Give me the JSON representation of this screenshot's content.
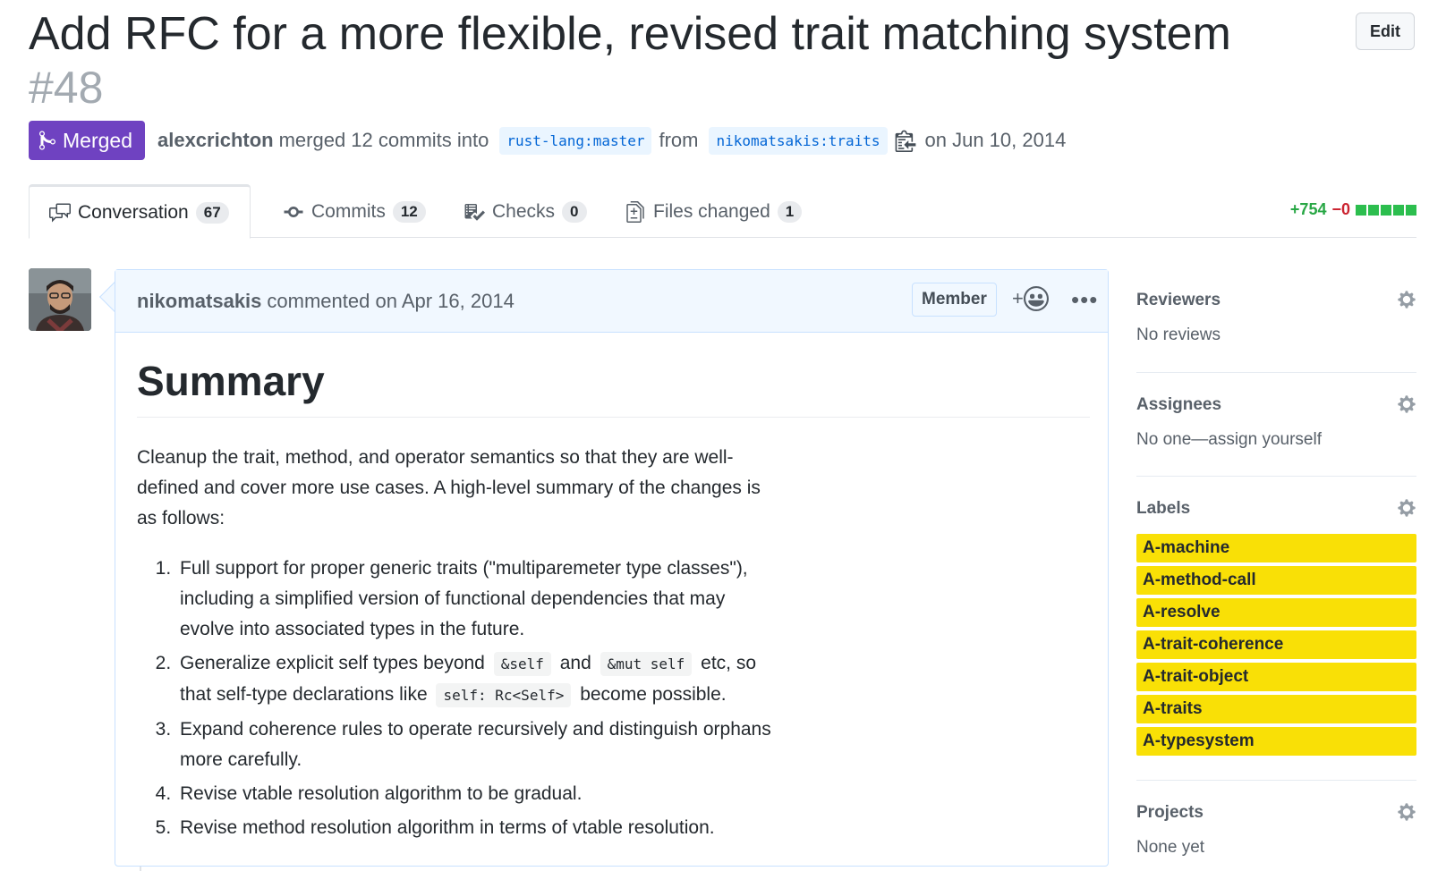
{
  "pr": {
    "title": "Add RFC for a more flexible, revised trait matching system",
    "number": "#48",
    "edit_label": "Edit",
    "state_label": "Merged",
    "merged_by": "alexcrichton",
    "merged_text": "merged 12 commits into",
    "base_branch": "rust-lang:master",
    "from_text": "from",
    "head_branch": "nikomatsakis:traits",
    "date_text": "on Jun 10, 2014"
  },
  "tabs": [
    {
      "label": "Conversation",
      "count": "67",
      "icon": "comment-discussion-icon"
    },
    {
      "label": "Commits",
      "count": "12",
      "icon": "git-commit-icon"
    },
    {
      "label": "Checks",
      "count": "0",
      "icon": "checklist-icon"
    },
    {
      "label": "Files changed",
      "count": "1",
      "icon": "file-diff-icon"
    }
  ],
  "diffstat": {
    "additions": "+754",
    "deletions": "−0"
  },
  "comment": {
    "author": "nikomatsakis",
    "action": "commented on Apr 16, 2014",
    "badge": "Member",
    "heading": "Summary",
    "intro": "Cleanup the trait, method, and operator semantics so that they are well-defined and cover more use cases. A high-level summary of the changes is as follows:",
    "items": {
      "i1": "Full support for proper generic traits (\"multiparemeter type classes\"), including a simplified version of functional dependencies that may evolve into associated types in the future.",
      "i2_a": "Generalize explicit self types beyond",
      "i2_code1": "&self",
      "i2_b": "and",
      "i2_code2": "&mut self",
      "i2_c": "etc, so that self-type declarations like",
      "i2_code3": "self: Rc<Self>",
      "i2_d": "become possible.",
      "i3": "Expand coherence rules to operate recursively and distinguish orphans more carefully.",
      "i4": "Revise vtable resolution algorithm to be gradual.",
      "i5": "Revise method resolution algorithm in terms of vtable resolution."
    }
  },
  "sidebar": {
    "reviewers": {
      "title": "Reviewers",
      "value": "No reviews"
    },
    "assignees": {
      "title": "Assignees",
      "value": "No one—assign yourself"
    },
    "labels": {
      "title": "Labels",
      "items": [
        "A-machine",
        "A-method-call",
        "A-resolve",
        "A-trait-coherence",
        "A-trait-object",
        "A-traits",
        "A-typesystem"
      ],
      "color": "#f9e006"
    },
    "projects": {
      "title": "Projects",
      "value": "None yet"
    }
  },
  "colors": {
    "merged": "#6f42c1",
    "additions": "#28a745",
    "deletions": "#cb2431",
    "link": "#0366d6"
  }
}
